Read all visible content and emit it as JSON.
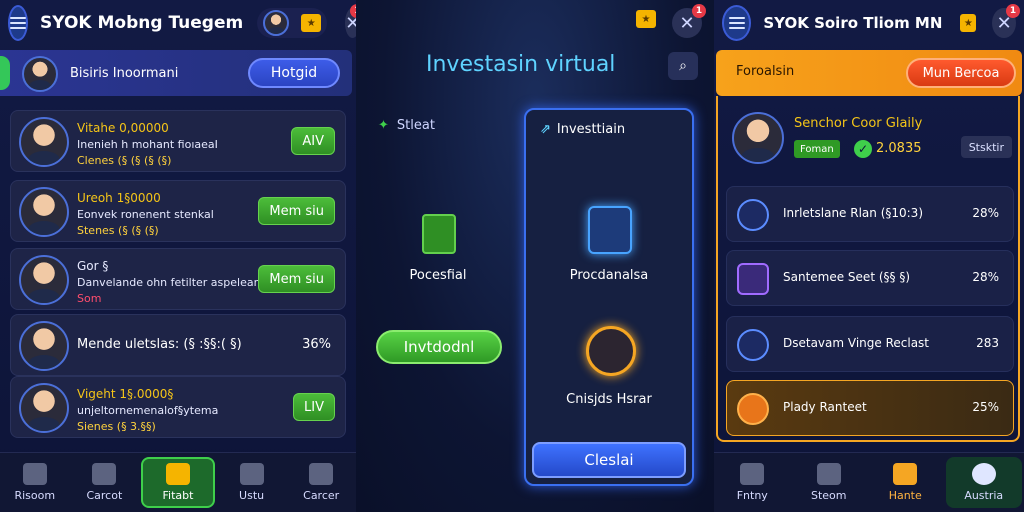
{
  "left": {
    "title": "SYOK Mobng Tuegem",
    "profile_name": "Bisiris Inoormani",
    "profile_button": "Hotgid",
    "cards": [
      {
        "t1": "Vitahe 0,00000",
        "t2": "Inenieh h mohant fioıaeaI",
        "t3": "Clenes (§ (§ (§ (§)",
        "btn": "AIV"
      },
      {
        "t1": "Ureoh 1§0000",
        "t2": "Eonvek ronenent stenkal",
        "t3": "Stenes (§ (§ (§)",
        "btn": "Mem siu"
      },
      {
        "t1": "Gor §",
        "t2": "Danvelande ohn fetilter aspelean",
        "t3": "Som",
        "btn": "Mem siu"
      },
      {
        "single": "Mende uletslas: (§ :§§:( §)",
        "pct": "36%"
      },
      {
        "t1": "Vigeht 1§.0000§",
        "t2": "unjeltornemenalof§ytema",
        "t3": "Sienes (§ 3.§§)",
        "btn": "LIV"
      }
    ],
    "nav": [
      {
        "label": "Risoom"
      },
      {
        "label": "Carcot"
      },
      {
        "label": "Fitabt"
      },
      {
        "label": "Ustu"
      },
      {
        "label": "Carcer"
      }
    ]
  },
  "mid": {
    "title": "Investasin virtual",
    "left_label": "Stleat",
    "left_caption": "Pocesfial",
    "left_button": "Invtdodnl",
    "card_header": "Investtiain",
    "card_caption1": "Procdanalsa",
    "card_caption2": "Cnisjds Hsrar",
    "card_button": "Cleslai"
  },
  "right": {
    "title": "SYOK Soiro Tliom MN",
    "promo_label": "Foroalsin",
    "promo_button": "Mun Bercoa",
    "profile": {
      "t1": "Senchor Coor Glaily",
      "tag": "Foman",
      "value": "2.0835",
      "button": "Stsktir"
    },
    "rows": [
      {
        "label": "Inrletslane Rlan (§10:3)",
        "pct": "28%"
      },
      {
        "label": "Santemee Seet (§§ §)",
        "pct": "28%"
      },
      {
        "label": "Dsetavam Vinge Reclast",
        "pct": "283"
      },
      {
        "label": "Plady Ranteet",
        "pct": "25%"
      }
    ],
    "nav": [
      {
        "label": "Fntny"
      },
      {
        "label": "Steom"
      },
      {
        "label": "Hante"
      },
      {
        "label": "Austria"
      }
    ]
  },
  "colors": {
    "accent_green": "#3fcf4b",
    "accent_blue": "#3a6ff0",
    "accent_orange": "#f5a623",
    "title_cyan": "#5fd3ff"
  }
}
